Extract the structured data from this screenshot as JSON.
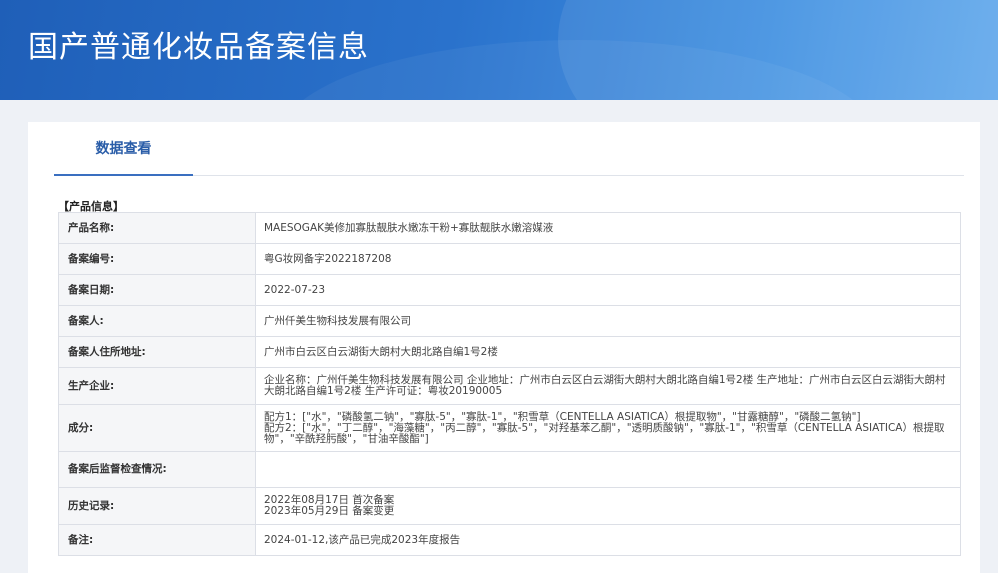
{
  "page": {
    "title": "国产普通化妆品备案信息"
  },
  "tabs": [
    {
      "label": "数据查看"
    }
  ],
  "section": {
    "label": "【产品信息】"
  },
  "rows": [
    {
      "key": "产品名称:",
      "value": "MAESOGAK美修加寡肽靓肤水嫩冻干粉+寡肽靓肤水嫩溶媒液"
    },
    {
      "key": "备案编号:",
      "value": "粤G妆网备字2022187208"
    },
    {
      "key": "备案日期:",
      "value": "2022-07-23"
    },
    {
      "key": "备案人:",
      "value": "广州仟美生物科技发展有限公司"
    },
    {
      "key": "备案人住所地址:",
      "value": "广州市白云区白云湖街大朗村大朗北路自编1号2楼"
    },
    {
      "key": "生产企业:",
      "value": "企业名称：广州仟美生物科技发展有限公司 企业地址：广州市白云区白云湖街大朗村大朗北路自编1号2楼 生产地址：广州市白云区白云湖街大朗村大朗北路自编1号2楼 生产许可证：粤妆20190005"
    },
    {
      "key": "成分:",
      "value": "配方1：[\"水\"，\"磷酸氢二钠\"，\"寡肽-5\"，\"寡肽-1\"，\"积雪草（CENTELLA ASIATICA）根提取物\"，\"甘露糖醇\"，\"磷酸二氢钠\"]\n配方2：[\"水\"，\"丁二醇\"，\"海藻糖\"，\"丙二醇\"，\"寡肽-5\"，\"对羟基苯乙酮\"，\"透明质酸钠\"，\"寡肽-1\"，\"积雪草（CENTELLA ASIATICA）根提取物\"，\"辛酰羟肟酸\"，\"甘油辛酸酯\"]"
    },
    {
      "key": "备案后监督检查情况:",
      "value": ""
    },
    {
      "key": "历史记录:",
      "value": "2022年08月17日 首次备案\n2023年05月29日 备案变更"
    },
    {
      "key": "备注:",
      "value": "2024-01-12,该产品已完成2023年度报告"
    }
  ]
}
